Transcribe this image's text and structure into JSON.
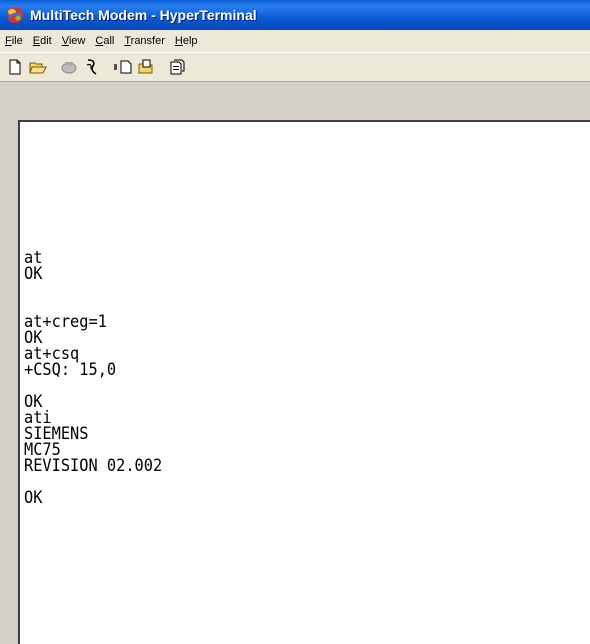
{
  "window": {
    "title": "MultiTech Modem - HyperTerminal",
    "icon": "hyperterminal-app-icon"
  },
  "menu": {
    "items": [
      {
        "key": "F",
        "rest": "ile"
      },
      {
        "key": "E",
        "rest": "dit"
      },
      {
        "key": "V",
        "rest": "iew"
      },
      {
        "key": "C",
        "rest": "all"
      },
      {
        "key": "T",
        "rest": "ransfer"
      },
      {
        "key": "H",
        "rest": "elp"
      }
    ]
  },
  "toolbar": {
    "buttons": [
      "new-icon",
      "open-folder-icon",
      "dial-phone-icon",
      "disconnect-icon",
      "send-icon",
      "receive-icon",
      "properties-icon"
    ]
  },
  "terminal": {
    "lines": [
      "at",
      "OK",
      "",
      "",
      "at+creg=1",
      "OK",
      "at+csq",
      "+CSQ: 15,0",
      "",
      "OK",
      "ati",
      "SIEMENS",
      "MC75",
      "REVISION 02.002",
      "",
      "OK"
    ]
  }
}
